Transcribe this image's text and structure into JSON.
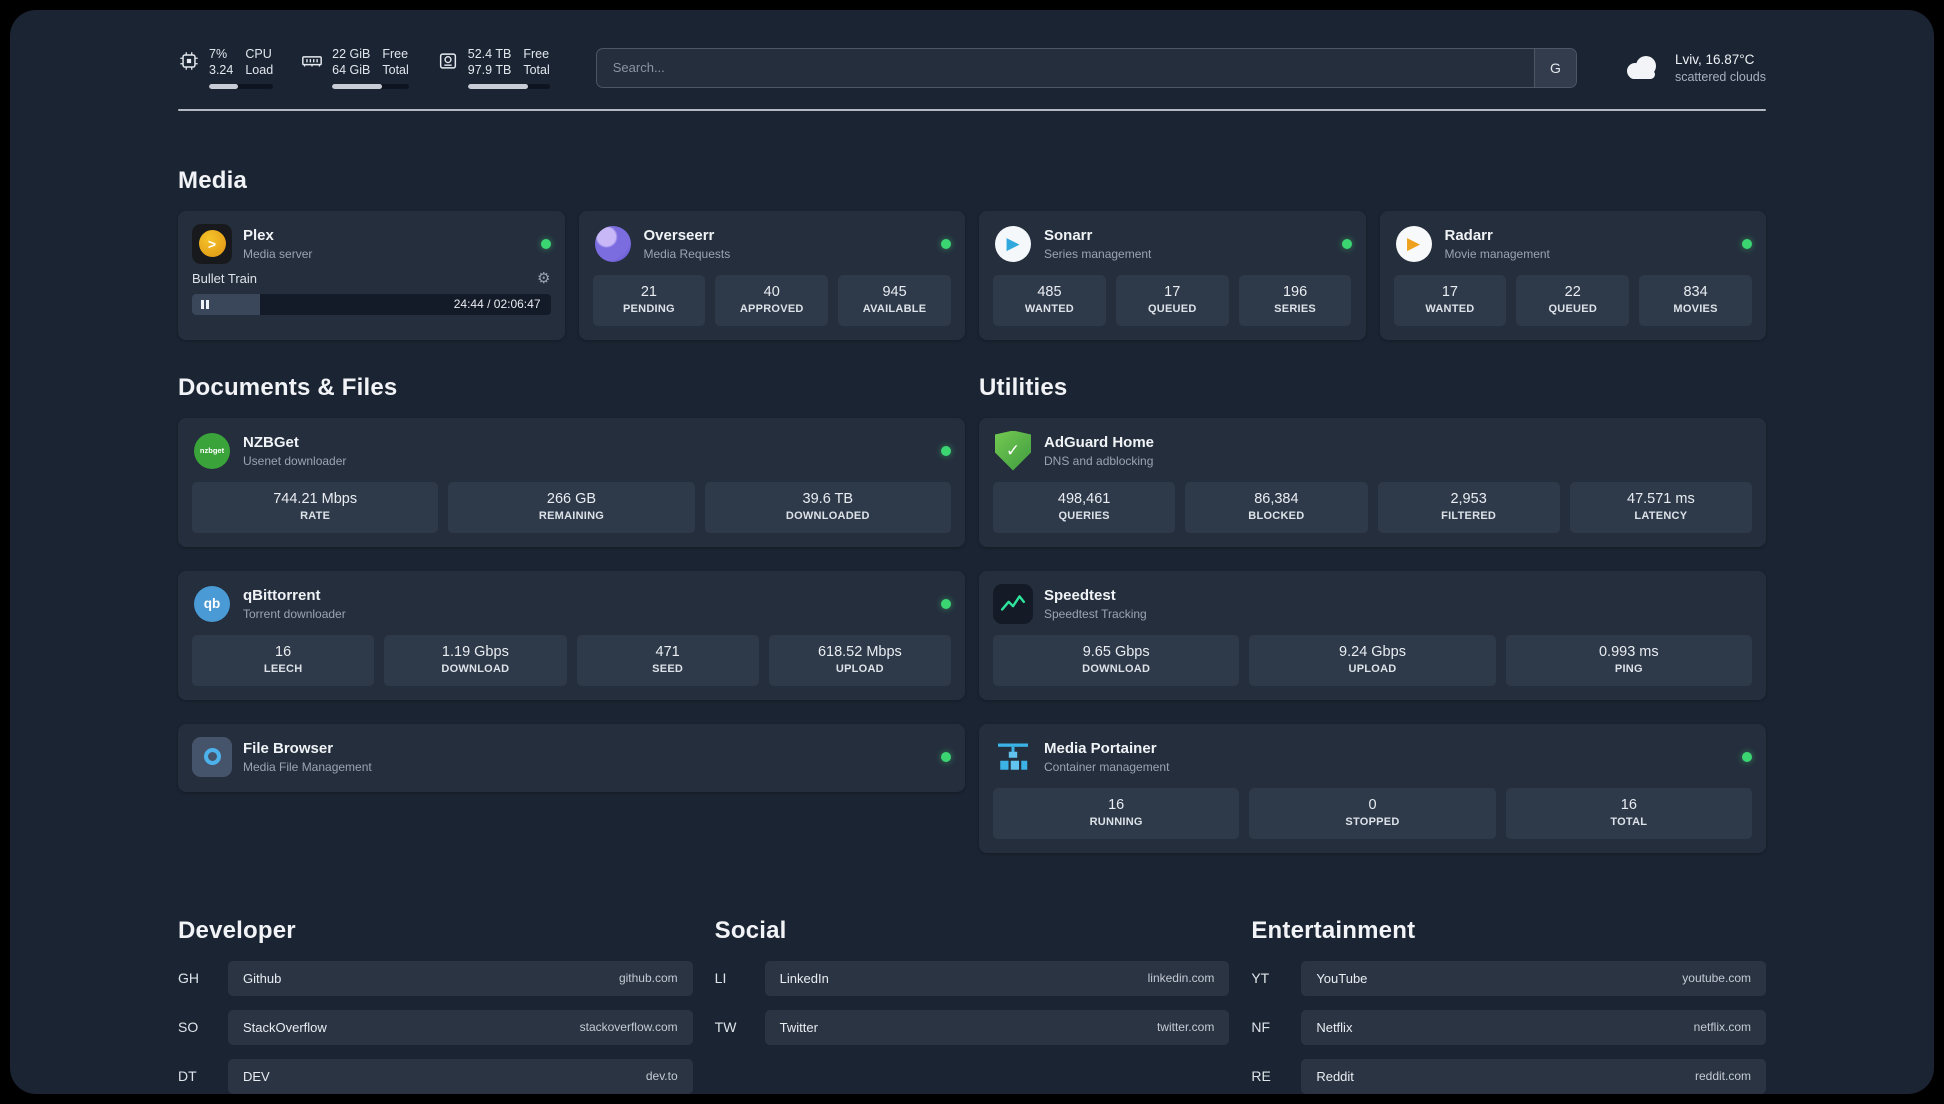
{
  "topbar": {
    "cpu": {
      "value1": "7%",
      "value2": "3.24",
      "label1": "CPU",
      "label2": "Load",
      "bar": 45
    },
    "memory": {
      "value1": "22 GiB",
      "value2": "64 GiB",
      "label1": "Free",
      "label2": "Total",
      "bar": 65
    },
    "disk": {
      "value1": "52.4 TB",
      "value2": "97.9 TB",
      "label1": "Free",
      "label2": "Total",
      "bar": 74
    },
    "search": {
      "placeholder": "Search...",
      "provider_label": "G"
    },
    "weather": {
      "location": "Lviv, 16.87°C",
      "condition": "scattered clouds"
    }
  },
  "glyphs": {
    "plex": ">",
    "sonarr": "▶",
    "radarr": "▶",
    "check": "✓",
    "gear": "⚙",
    "nzbget": "nzbget",
    "qbit": "qb"
  },
  "media": {
    "heading": "Media",
    "plex": {
      "name": "Plex",
      "subtitle": "Media server",
      "now_playing": "Bullet Train",
      "time": "24:44 / 02:06:47",
      "progress": 19
    },
    "overseerr": {
      "name": "Overseerr",
      "subtitle": "Media Requests",
      "stats": [
        {
          "value": "21",
          "label": "PENDING"
        },
        {
          "value": "40",
          "label": "APPROVED"
        },
        {
          "value": "945",
          "label": "AVAILABLE"
        }
      ]
    },
    "sonarr": {
      "name": "Sonarr",
      "subtitle": "Series management",
      "stats": [
        {
          "value": "485",
          "label": "WANTED"
        },
        {
          "value": "17",
          "label": "QUEUED"
        },
        {
          "value": "196",
          "label": "SERIES"
        }
      ]
    },
    "radarr": {
      "name": "Radarr",
      "subtitle": "Movie management",
      "stats": [
        {
          "value": "17",
          "label": "WANTED"
        },
        {
          "value": "22",
          "label": "QUEUED"
        },
        {
          "value": "834",
          "label": "MOVIES"
        }
      ]
    }
  },
  "documents": {
    "heading": "Documents & Files",
    "nzbget": {
      "name": "NZBGet",
      "subtitle": "Usenet downloader",
      "stats": [
        {
          "value": "744.21 Mbps",
          "label": "RATE"
        },
        {
          "value": "266 GB",
          "label": "REMAINING"
        },
        {
          "value": "39.6 TB",
          "label": "DOWNLOADED"
        }
      ]
    },
    "qbittorrent": {
      "name": "qBittorrent",
      "subtitle": "Torrent downloader",
      "stats": [
        {
          "value": "16",
          "label": "LEECH"
        },
        {
          "value": "1.19 Gbps",
          "label": "DOWNLOAD"
        },
        {
          "value": "471",
          "label": "SEED"
        },
        {
          "value": "618.52 Mbps",
          "label": "UPLOAD"
        }
      ]
    },
    "filebrowser": {
      "name": "File Browser",
      "subtitle": "Media File Management"
    }
  },
  "utilities": {
    "heading": "Utilities",
    "adguard": {
      "name": "AdGuard Home",
      "subtitle": "DNS and adblocking",
      "stats": [
        {
          "value": "498,461",
          "label": "QUERIES"
        },
        {
          "value": "86,384",
          "label": "BLOCKED"
        },
        {
          "value": "2,953",
          "label": "FILTERED"
        },
        {
          "value": "47.571 ms",
          "label": "LATENCY"
        }
      ]
    },
    "speedtest": {
      "name": "Speedtest",
      "subtitle": "Speedtest Tracking",
      "stats": [
        {
          "value": "9.65 Gbps",
          "label": "DOWNLOAD"
        },
        {
          "value": "9.24 Gbps",
          "label": "UPLOAD"
        },
        {
          "value": "0.993 ms",
          "label": "PING"
        }
      ]
    },
    "portainer": {
      "name": "Media Portainer",
      "subtitle": "Container management",
      "stats": [
        {
          "value": "16",
          "label": "RUNNING"
        },
        {
          "value": "0",
          "label": "STOPPED"
        },
        {
          "value": "16",
          "label": "TOTAL"
        }
      ]
    }
  },
  "bookmarks": {
    "developer": {
      "heading": "Developer",
      "items": [
        {
          "abbr": "GH",
          "name": "Github",
          "url": "github.com"
        },
        {
          "abbr": "SO",
          "name": "StackOverflow",
          "url": "stackoverflow.com"
        },
        {
          "abbr": "DT",
          "name": "DEV",
          "url": "dev.to"
        }
      ]
    },
    "social": {
      "heading": "Social",
      "items": [
        {
          "abbr": "LI",
          "name": "LinkedIn",
          "url": "linkedin.com"
        },
        {
          "abbr": "TW",
          "name": "Twitter",
          "url": "twitter.com"
        }
      ]
    },
    "entertainment": {
      "heading": "Entertainment",
      "items": [
        {
          "abbr": "YT",
          "name": "YouTube",
          "url": "youtube.com"
        },
        {
          "abbr": "NF",
          "name": "Netflix",
          "url": "netflix.com"
        },
        {
          "abbr": "RE",
          "name": "Reddit",
          "url": "reddit.com"
        }
      ]
    }
  },
  "colors": {
    "background": "#1b2432",
    "card": "#252e3d",
    "tile": "#2e3949",
    "status_green": "#3bd671"
  }
}
